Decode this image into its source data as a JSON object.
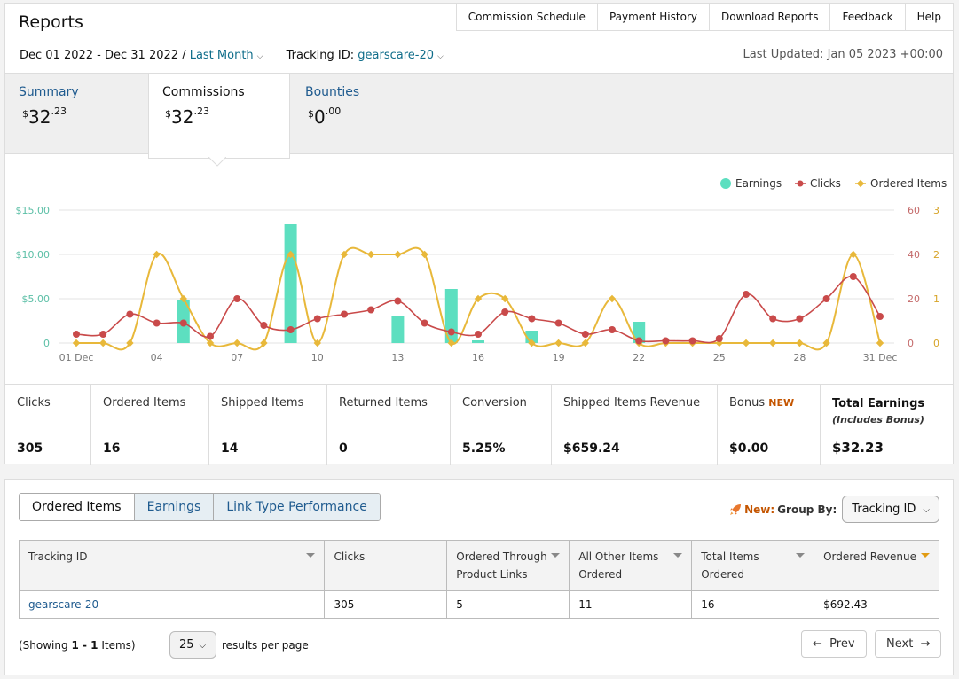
{
  "header": {
    "title": "Reports",
    "links": [
      "Commission Schedule",
      "Payment History",
      "Download Reports",
      "Feedback",
      "Help"
    ],
    "date_range": "Dec 01 2022 - Dec 31 2022 /",
    "date_preset": "Last Month",
    "tracking_label": "Tracking ID:",
    "tracking_value": "gearscare-20",
    "last_updated": "Last Updated: Jan 05 2023 +00:00"
  },
  "tabs": [
    {
      "name": "Summary",
      "dollar": "$",
      "whole": "32",
      "cents": ".23"
    },
    {
      "name": "Commissions",
      "dollar": "$",
      "whole": "32",
      "cents": ".23"
    },
    {
      "name": "Bounties",
      "dollar": "$",
      "whole": "0",
      "cents": ".00"
    }
  ],
  "stats": [
    {
      "label": "Clicks",
      "value": "305"
    },
    {
      "label": "Ordered Items",
      "value": "16"
    },
    {
      "label": "Shipped Items",
      "value": "14"
    },
    {
      "label": "Returned Items",
      "value": "0"
    },
    {
      "label": "Conversion",
      "value": "5.25%"
    },
    {
      "label": "Shipped Items Revenue",
      "value": "$659.24"
    },
    {
      "label": "Bonus",
      "badge": "NEW",
      "value": "$0.00"
    },
    {
      "label": "Total Earnings",
      "sub": "(Includes Bonus)",
      "value": "$32.23"
    }
  ],
  "chart_data": {
    "type": "line",
    "legend": [
      "Earnings",
      "Clicks",
      "Ordered Items"
    ],
    "colors": {
      "earnings": "#5ddfc0",
      "clicks": "#c94a4a",
      "ordered": "#e8b83a"
    },
    "x_ticks": [
      "01 Dec",
      "04",
      "07",
      "10",
      "13",
      "16",
      "19",
      "22",
      "25",
      "28",
      "31 Dec"
    ],
    "y_left_ticks": [
      "$15.00",
      "$10.00",
      "$5.00",
      "0"
    ],
    "y_mid_ticks": [
      "60",
      "40",
      "20",
      "0"
    ],
    "y_right_ticks": [
      "3",
      "2",
      "1",
      "0"
    ],
    "days": [
      1,
      2,
      3,
      4,
      5,
      6,
      7,
      8,
      9,
      10,
      11,
      12,
      13,
      14,
      15,
      16,
      17,
      18,
      19,
      20,
      21,
      22,
      23,
      24,
      25,
      26,
      27,
      28,
      29,
      30,
      31
    ],
    "earnings": [
      0,
      0,
      0,
      0,
      4.9,
      0,
      0,
      0,
      13.4,
      0,
      0,
      0,
      3.1,
      0,
      6.1,
      0.3,
      0,
      1.4,
      0,
      0,
      0,
      2.4,
      0,
      0,
      0,
      0,
      0,
      0,
      0,
      0,
      0
    ],
    "clicks": [
      4,
      4,
      13,
      9,
      9,
      3,
      20,
      8,
      6,
      11,
      13,
      15,
      19,
      9,
      5,
      4,
      14,
      11,
      9,
      4,
      6,
      1,
      1,
      1,
      2,
      22,
      11,
      11,
      20,
      30,
      12
    ],
    "ordered_items": [
      0,
      0,
      0,
      2,
      1,
      0,
      0,
      0,
      2,
      0,
      2,
      2,
      2,
      2,
      0,
      1,
      1,
      0,
      0,
      0,
      1,
      0,
      0,
      0,
      0,
      0,
      0,
      0,
      0,
      2,
      0
    ]
  },
  "bottom": {
    "tabs": [
      "Ordered Items",
      "Earnings",
      "Link Type Performance"
    ],
    "new_label": "New:",
    "groupby_label": "Group By:",
    "groupby_value": "Tracking ID",
    "columns": [
      "Tracking ID",
      "Clicks",
      "Ordered Through Product Links",
      "All Other Items Ordered",
      "Total Items Ordered",
      "Ordered Revenue"
    ],
    "rows": [
      [
        "gearscare-20",
        "305",
        "5",
        "11",
        "16",
        "$692.43"
      ]
    ],
    "showing_prefix": "(Showing",
    "showing_range": "1 - 1",
    "showing_suffix": "Items)",
    "per_page": "25",
    "per_page_label": "results per page",
    "prev": "Prev",
    "next": "Next"
  }
}
